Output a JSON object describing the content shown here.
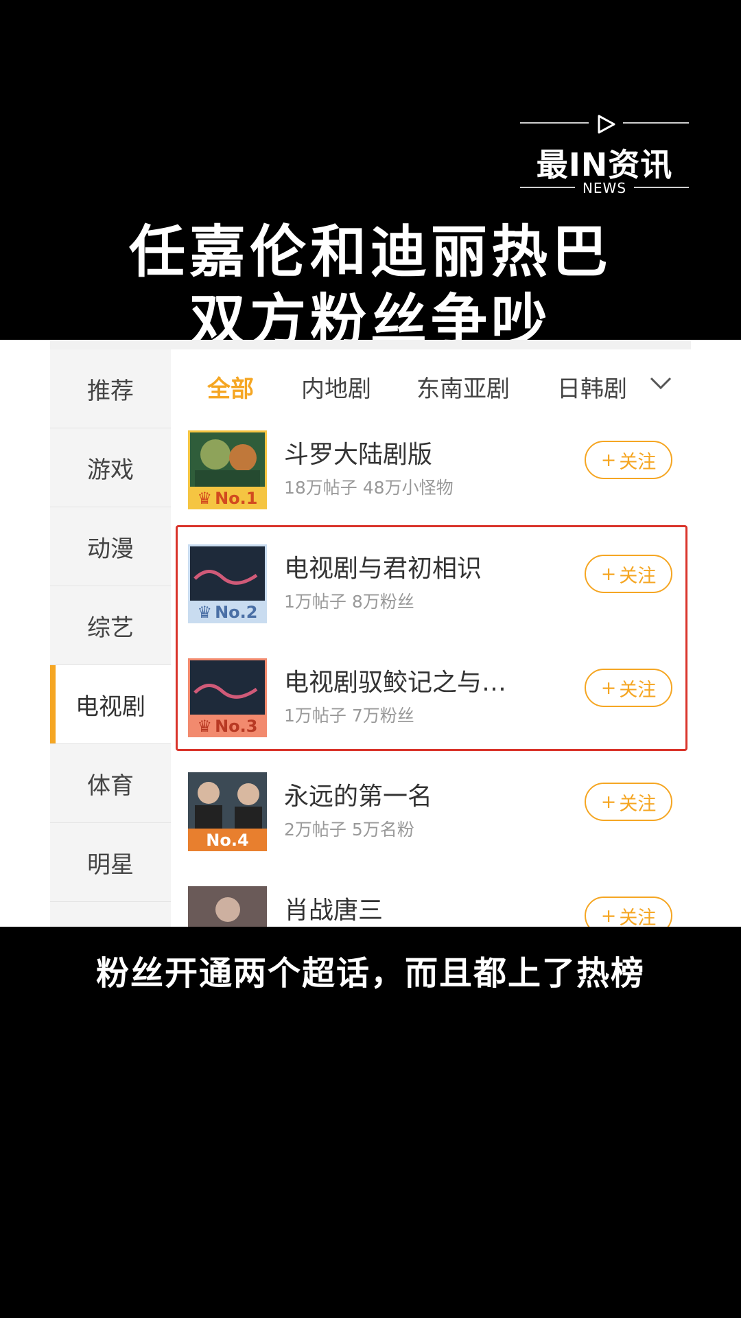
{
  "logo": {
    "brand": "最IN资讯",
    "sub": "NEWS"
  },
  "headline": {
    "line1": "任嘉伦和迪丽热巴",
    "line2": "双方粉丝争吵"
  },
  "sidebar": {
    "items": [
      {
        "label": "推荐"
      },
      {
        "label": "游戏"
      },
      {
        "label": "动漫"
      },
      {
        "label": "综艺"
      },
      {
        "label": "电视剧"
      },
      {
        "label": "体育"
      },
      {
        "label": "明星"
      }
    ],
    "active": "电视剧"
  },
  "tabs": [
    {
      "label": "全部"
    },
    {
      "label": "内地剧"
    },
    {
      "label": "东南亚剧"
    },
    {
      "label": "日韩剧"
    }
  ],
  "list": [
    {
      "rank": "No.1",
      "title": "斗罗大陆剧版",
      "meta": "18万帖子 48万小怪物",
      "follow": "关注"
    },
    {
      "rank": "No.2",
      "title": "电视剧与君初相识",
      "meta": "1万帖子 8万粉丝",
      "follow": "关注"
    },
    {
      "rank": "No.3",
      "title": "电视剧驭鲛记之与…",
      "meta": "1万帖子 7万粉丝",
      "follow": "关注"
    },
    {
      "rank": "No.4",
      "title": "永远的第一名",
      "meta": "2万帖子 5万名粉",
      "follow": "关注"
    },
    {
      "rank": "",
      "title": "肖战唐三",
      "meta": "",
      "follow": "关注"
    }
  ],
  "subtitle": "粉丝开通两个超话，而且都上了热榜",
  "colors": {
    "accent": "#f5a623",
    "highlight": "#d9342b"
  }
}
